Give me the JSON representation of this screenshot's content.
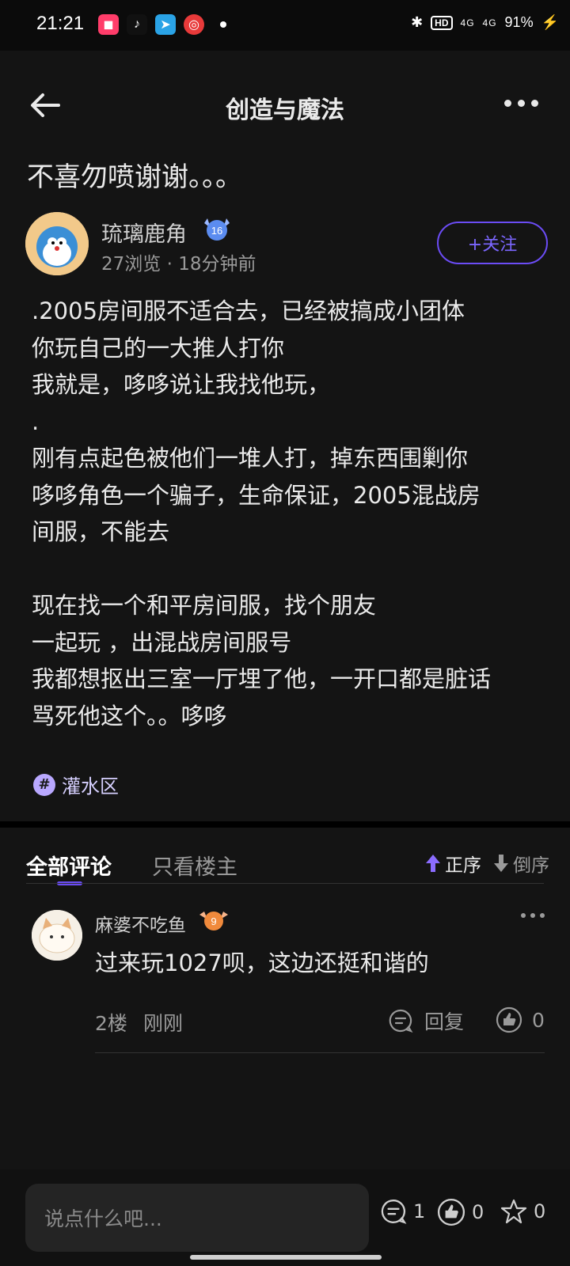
{
  "status_bar": {
    "time": "21:21",
    "hd_label": "HD",
    "signal1": "4G",
    "signal2": "4G",
    "battery": "91%"
  },
  "header": {
    "title": "创造与魔法"
  },
  "post": {
    "title": "不喜勿喷谢谢。。。",
    "author_name": "琉璃鹿角",
    "author_level": "16",
    "meta": "27浏览 · 18分钟前",
    "follow_label": "+关注",
    "content": ".2005房间服不适合去，已经被搞成小团体\n你玩自己的一大推人打你\n我就是，哆哆说让我找他玩，\n.\n刚有点起色被他们一堆人打，掉东西围剿你\n哆哆角色一个骗子，生命保证，2005混战房\n间服，不能去\n\n现在找一个和平房间服，找个朋友\n一起玩 ，出混战房间服号\n我都想抠出三室一厅埋了他，一开口都是脏话\n骂死他这个。。哆哆",
    "tag": "灌水区"
  },
  "comments_tabs": {
    "all": "全部评论",
    "op_only": "只看楼主",
    "sort_asc": "正序",
    "sort_desc": "倒序"
  },
  "comments": [
    {
      "name": "麻婆不吃鱼",
      "level": "9",
      "text": "过来玩1027呗，这边还挺和谐的",
      "floor": "2楼",
      "time": "刚刚",
      "reply_label": "回复",
      "likes": "0"
    }
  ],
  "bottom_bar": {
    "placeholder": "说点什么吧...",
    "comment_count": "1",
    "like_count": "0",
    "fav_count": "0"
  },
  "colors": {
    "accent": "#6b4cf5",
    "background": "#141414"
  }
}
